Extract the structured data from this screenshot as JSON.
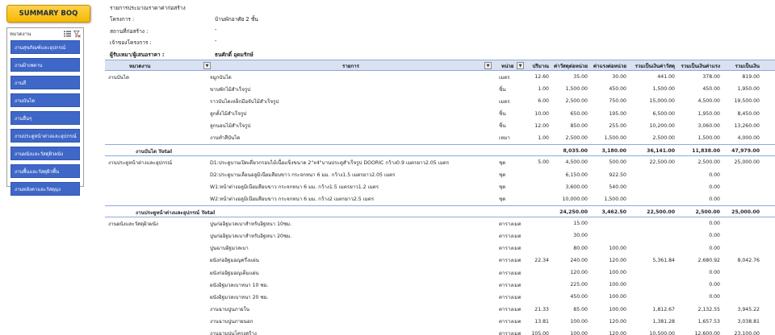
{
  "summary_button": "SUMMARY BOQ",
  "slicer": {
    "title": "หมวดงาน",
    "items": [
      "งานสุขภัณฑ์และอุปกรณ์",
      "งานฝ้าเพดาน",
      "งานสี",
      "งานบันได",
      "งานอื่นๆ",
      "งานประตูหน้าต่างและอุปกรณ์",
      "งานผนังและวัสดุผิวผนัง",
      "งานพื้นและวัสดุผิวพื้น",
      "งานหลังคาและวัสดุมุง"
    ]
  },
  "header": {
    "report_title": "รายการประมาณราคาค่าก่อสร้าง",
    "project_label": "โครงการ :",
    "project_value": "บ้านพักอาศัย 2 ชั้น",
    "location_label": "สถานที่ก่อสร้าง :",
    "location_value": "-",
    "owner_label": "เจ้าของโครงการ :",
    "owner_value": "-",
    "estimator_label": "ผู้รับเหมา/ผู้เสนอราคา :",
    "estimator_value": "ธนศักดิ์ อุดมรักษ์"
  },
  "table": {
    "columns": {
      "category": "หมวดงาน",
      "item": "รายการ",
      "unit": "หน่วย",
      "qty": "ปริมาณ",
      "mat_unit": "ค่าวัสดุต่อหน่วย",
      "lab_unit": "ค่าแรงต่อหน่วย",
      "mat_total": "รวมเป็นเงินค่าวัสดุ",
      "lab_total": "รวมเป็นเงินค่าแรง",
      "grand_total": "รวมเป็นเงิน"
    },
    "rows": [
      {
        "category": "งานบันได",
        "item": "จมูกบันได",
        "unit": "เมตร",
        "qty": "12.60",
        "mat_unit": "35.00",
        "lab_unit": "30.00",
        "mat_total": "441.00",
        "lab_total": "378.00",
        "grand_total": "819.00"
      },
      {
        "category": "",
        "item": "ขาบพักไม้สำเร็จรูป",
        "unit": "ชิ้น",
        "qty": "1.00",
        "mat_unit": "1,500.00",
        "lab_unit": "450.00",
        "mat_total": "1,500.00",
        "lab_total": "450.00",
        "grand_total": "1,950.00"
      },
      {
        "category": "",
        "item": "ราวบันไดเหล็กมือจับไม้สำเร็จรูป",
        "unit": "เมตร",
        "qty": "6.00",
        "mat_unit": "2,500.00",
        "lab_unit": "750.00",
        "mat_total": "15,000.00",
        "lab_total": "4,500.00",
        "grand_total": "19,500.00"
      },
      {
        "category": "",
        "item": "ลูกตั้งไม้สำเร็จรูป",
        "unit": "ชิ้น",
        "qty": "10.00",
        "mat_unit": "650.00",
        "lab_unit": "195.00",
        "mat_total": "6,500.00",
        "lab_total": "1,950.00",
        "grand_total": "8,450.00"
      },
      {
        "category": "",
        "item": "ลูกนอนไม้สำเร็จรูป",
        "unit": "ชิ้น",
        "qty": "12.00",
        "mat_unit": "850.00",
        "lab_unit": "255.00",
        "mat_total": "10,200.00",
        "lab_total": "3,060.00",
        "grand_total": "13,260.00"
      },
      {
        "category": "",
        "item": "งานทำสีบันได",
        "unit": "เหมา",
        "qty": "1.00",
        "mat_unit": "2,500.00",
        "lab_unit": "1,500.00",
        "mat_total": "2,500.00",
        "lab_total": "1,500.00",
        "grand_total": "4,000.00"
      },
      {
        "total": true,
        "label": "งานบันได Total",
        "mat_unit": "8,035.00",
        "lab_unit": "3,180.00",
        "mat_total": "36,141.00",
        "lab_total": "11,838.00",
        "grand_total": "47,979.00"
      },
      {
        "category": "งานประตูหน้าต่างและอุปกรณ์",
        "item": "D1:ประตูบานเปิดเดี่ยวกรอบไม้เนื้อแข็งขนาด 2\"x4\"บานประตูสำเร็จรูป DOORIC  กว้าง0.9  เมตรยาว2.05 เมตร",
        "unit": "ชุด",
        "qty": "5.00",
        "mat_unit": "4,500.00",
        "lab_unit": "500.00",
        "mat_total": "22,500.00",
        "lab_total": "2,500.00",
        "grand_total": "25,000.00"
      },
      {
        "category": "",
        "item": "D2:ประตูบานเลื่อนอลูมิเนียมสีอบขาว กระจกหนา 6 มม. กว้าง1.5  เมตรยาว2.05 เมตร",
        "unit": "ชุด",
        "qty": "",
        "mat_unit": "6,150.00",
        "lab_unit": "922.50",
        "mat_total": "",
        "lab_total": "0.00",
        "grand_total": ""
      },
      {
        "category": "",
        "item": "W1:หน้าต่างอลูมิเนียมสีอบขาว กระจกหนา 6 มม. กว้าง1.5  เมตรยาว1.2 เมตร",
        "unit": "ชุด",
        "qty": "",
        "mat_unit": "3,600.00",
        "lab_unit": "540.00",
        "mat_total": "",
        "lab_total": "0.00",
        "grand_total": ""
      },
      {
        "category": "",
        "item": "W2:หน้าต่างอลูมิเนียมสีอบขาว กระจกหนา 6 มม. กว้าง2  เมตรยาว2.5 เมตร",
        "unit": "ชุด",
        "qty": "",
        "mat_unit": "10,000.00",
        "lab_unit": "1,500.00",
        "mat_total": "",
        "lab_total": "0.00",
        "grand_total": ""
      },
      {
        "total": true,
        "label": "งานประตูหน้าต่างและอุปกรณ์ Total",
        "mat_unit": "24,250.00",
        "lab_unit": "3,462.50",
        "mat_total": "22,500.00",
        "lab_total": "2,500.00",
        "grand_total": "25,000.00"
      },
      {
        "category": "งานผนังและวัสดุผิวผนัง",
        "item": "ปูนก่ออิฐมวลเบาสำหรับอิฐหนา 10ซม.",
        "unit": "ตารางเมตร",
        "qty": "",
        "mat_unit": "15.00",
        "lab_unit": "",
        "mat_total": "",
        "lab_total": "0.00",
        "grand_total": ""
      },
      {
        "category": "",
        "item": "ปูนก่ออิฐมวลเบาสำหรับอิฐหนา 20ซม.",
        "unit": "ตารางเมตร",
        "qty": "",
        "mat_unit": "30.00",
        "lab_unit": "",
        "mat_total": "",
        "lab_total": "0.00",
        "grand_total": ""
      },
      {
        "category": "",
        "item": "ปูนฉาบอิฐมวลเบา",
        "unit": "ตารางเมตร",
        "qty": "",
        "mat_unit": "80.00",
        "lab_unit": "100.00",
        "mat_total": "",
        "lab_total": "0.00",
        "grand_total": ""
      },
      {
        "category": "",
        "item": "ผนังก่ออิฐมอญครึ่งแผ่น",
        "unit": "ตารางเมตร",
        "qty": "22.34",
        "mat_unit": "240.00",
        "lab_unit": "120.00",
        "mat_total": "5,361.84",
        "lab_total": "2,680.92",
        "grand_total": "8,042.76"
      },
      {
        "category": "",
        "item": "ผนังก่ออิฐมอญเต็มแผ่น",
        "unit": "ตารางเมตร",
        "qty": "",
        "mat_unit": "120.00",
        "lab_unit": "100.00",
        "mat_total": "",
        "lab_total": "0.00",
        "grand_total": ""
      },
      {
        "category": "",
        "item": "ผนังอิฐมวลเบาหนา 10 ซม.",
        "unit": "ตารางเมตร",
        "qty": "",
        "mat_unit": "225.00",
        "lab_unit": "100.00",
        "mat_total": "",
        "lab_total": "0.00",
        "grand_total": ""
      },
      {
        "category": "",
        "item": "ผนังอิฐมวลเบาหนา 20 ซม.",
        "unit": "ตารางเมตร",
        "qty": "",
        "mat_unit": "450.00",
        "lab_unit": "100.00",
        "mat_total": "",
        "lab_total": "0.00",
        "grand_total": ""
      },
      {
        "category": "",
        "item": "งานฉาบปูนภายใน",
        "unit": "ตารางเมตร",
        "qty": "21.33",
        "mat_unit": "85.00",
        "lab_unit": "100.00",
        "mat_total": "1,812.67",
        "lab_total": "2,132.55",
        "grand_total": "3,945.22"
      },
      {
        "category": "",
        "item": "งานฉาบปูนภายนอก",
        "unit": "ตารางเมตร",
        "qty": "13.81",
        "mat_unit": "100.00",
        "lab_unit": "120.00",
        "mat_total": "1,381.28",
        "lab_total": "1,657.53",
        "grand_total": "3,038.81"
      },
      {
        "category": "",
        "item": "งานฉาบปูนโครงสร้าง",
        "unit": "ตารางเมตร",
        "qty": "105.00",
        "mat_unit": "100.00",
        "lab_unit": "120.00",
        "mat_total": "10,500.00",
        "lab_total": "12,600.00",
        "grand_total": "23,100.00"
      }
    ]
  }
}
